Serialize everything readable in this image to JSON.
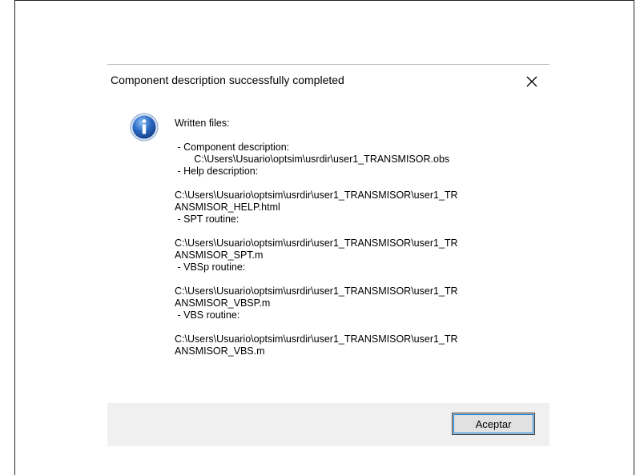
{
  "dialog": {
    "title": "Component description successfully completed",
    "close_icon": "close-x-icon",
    "info_icon": "information-icon",
    "message_lines": [
      "Written files:",
      "",
      " - Component description:",
      "       C:\\Users\\Usuario\\optsim\\usrdir\\user1_TRANSMISOR.obs",
      " - Help description:",
      "",
      "C:\\Users\\Usuario\\optsim\\usrdir\\user1_TRANSMISOR\\user1_TR",
      "ANSMISOR_HELP.html",
      " - SPT routine:",
      "",
      "C:\\Users\\Usuario\\optsim\\usrdir\\user1_TRANSMISOR\\user1_TR",
      "ANSMISOR_SPT.m",
      " - VBSp routine:",
      "",
      "C:\\Users\\Usuario\\optsim\\usrdir\\user1_TRANSMISOR\\user1_TR",
      "ANSMISOR_VBSP.m",
      " - VBS routine:",
      "",
      "C:\\Users\\Usuario\\optsim\\usrdir\\user1_TRANSMISOR\\user1_TR",
      "ANSMISOR_VBS.m"
    ],
    "ok_label": "Aceptar"
  },
  "colors": {
    "icon_blue": "#2a6bc4",
    "footer_bg": "#f0f0f0",
    "focus_border": "#0078d7"
  }
}
